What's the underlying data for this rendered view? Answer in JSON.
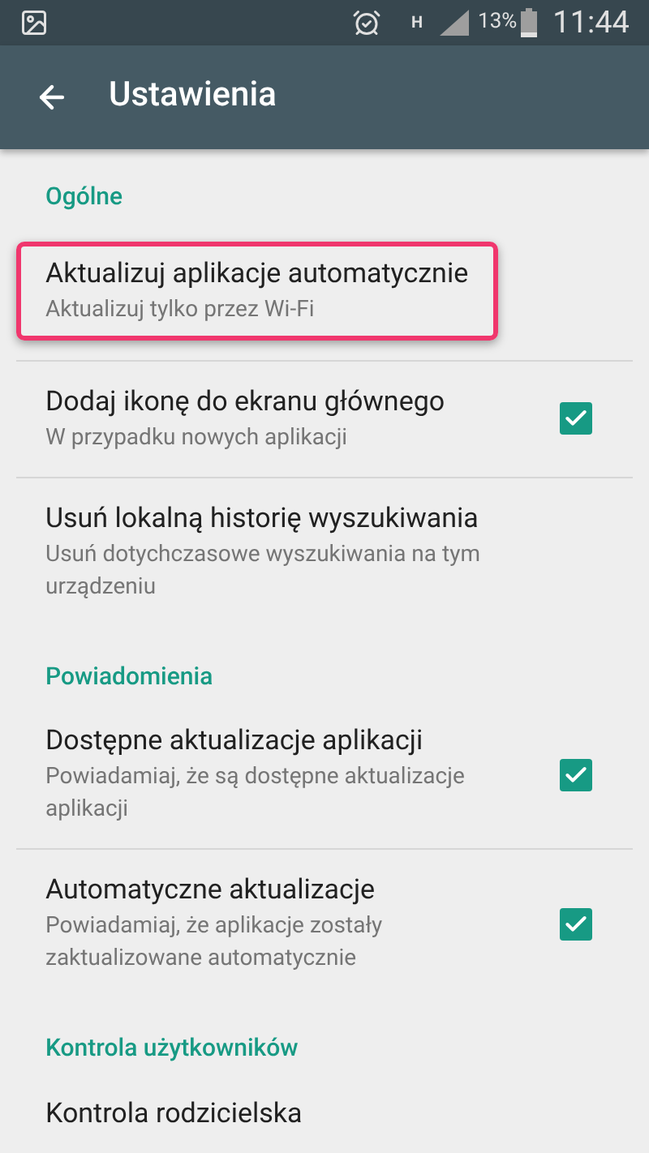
{
  "status_bar": {
    "battery": "13%",
    "time": "11:44",
    "network": "H"
  },
  "toolbar": {
    "title": "Ustawienia"
  },
  "sections": [
    {
      "header": "Ogólne",
      "items": [
        {
          "kind": "plain",
          "title": "Aktualizuj aplikacje automatycznie",
          "subtitle": "Aktualizuj tylko przez Wi-Fi",
          "highlighted": true
        },
        {
          "kind": "checkbox",
          "title": "Dodaj ikonę do ekranu głównego",
          "subtitle": "W przypadku nowych aplikacji",
          "checked": true,
          "highlighted": false
        },
        {
          "kind": "plain",
          "title": "Usuń lokalną historię wyszukiwania",
          "subtitle": "Usuń dotychczasowe wyszukiwania na tym urządzeniu",
          "highlighted": false
        }
      ]
    },
    {
      "header": "Powiadomienia",
      "items": [
        {
          "kind": "checkbox",
          "title": "Dostępne aktualizacje aplikacji",
          "subtitle": "Powiadamiaj, że są dostępne aktualizacje aplikacji",
          "checked": true,
          "highlighted": false
        },
        {
          "kind": "checkbox",
          "title": "Automatyczne aktualizacje",
          "subtitle": "Powiadamiaj, że aplikacje zostały zaktualizowane automatycznie",
          "checked": true,
          "highlighted": false
        }
      ]
    },
    {
      "header": "Kontrola użytkowników",
      "items": [
        {
          "kind": "plain",
          "title": "Kontrola rodzicielska",
          "highlighted": false
        }
      ]
    }
  ]
}
